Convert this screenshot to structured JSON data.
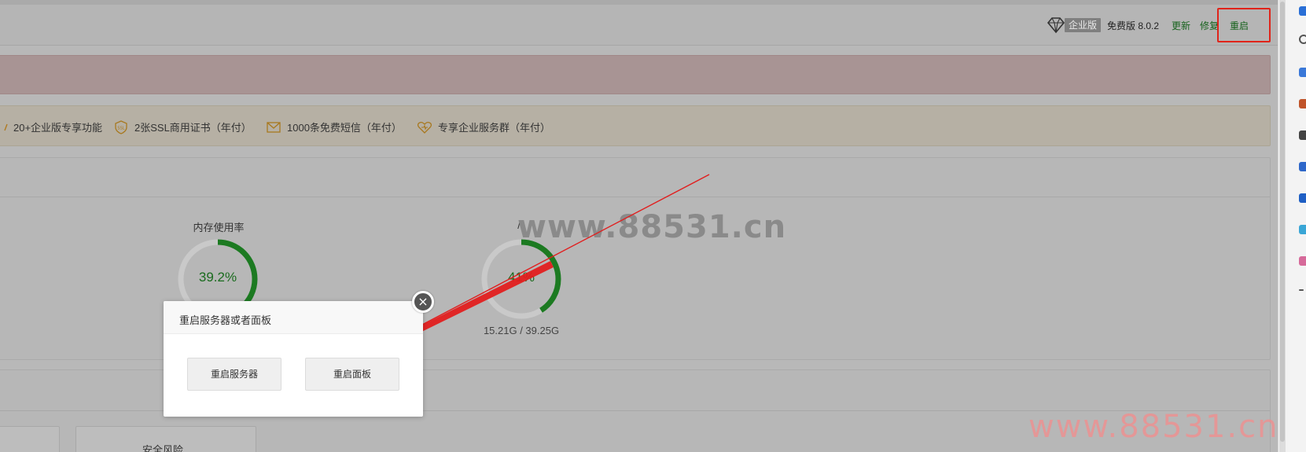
{
  "header": {
    "edition_badge": "企业版",
    "free_version": "免费版 8.0.2",
    "update_label": "更新",
    "repair_label": "修复",
    "restart_label": "重启"
  },
  "alert": {
    "mark": "."
  },
  "features": [
    {
      "label": "20+企业版专享功能",
      "icon": "check-icon"
    },
    {
      "label": "2张SSL商用证书（年付）",
      "icon": "ssl-shield-icon"
    },
    {
      "label": "1000条免费短信（年付）",
      "icon": "mail-icon"
    },
    {
      "label": "专享企业服务群（年付）",
      "icon": "heart-service-icon"
    }
  ],
  "status": {
    "memory": {
      "title": "内存使用率",
      "value": "39.2%",
      "percent": 39.2
    },
    "disk": {
      "title": "/",
      "value": "41%",
      "percent": 41,
      "usage": "15.21G / 39.25G"
    }
  },
  "bottom": {
    "card_label": "安全风险"
  },
  "watermark": {
    "center": "www.88531.cn",
    "corner": "www.88531.cn"
  },
  "modal": {
    "title": "重启服务器或者面板",
    "close_icon": "×",
    "btn_restart_server": "重启服务器",
    "btn_restart_panel": "重启面板"
  },
  "colors": {
    "accent_green": "#1a7a22",
    "highlight_red": "#e0241a",
    "modal_bg": "#ffffff"
  }
}
